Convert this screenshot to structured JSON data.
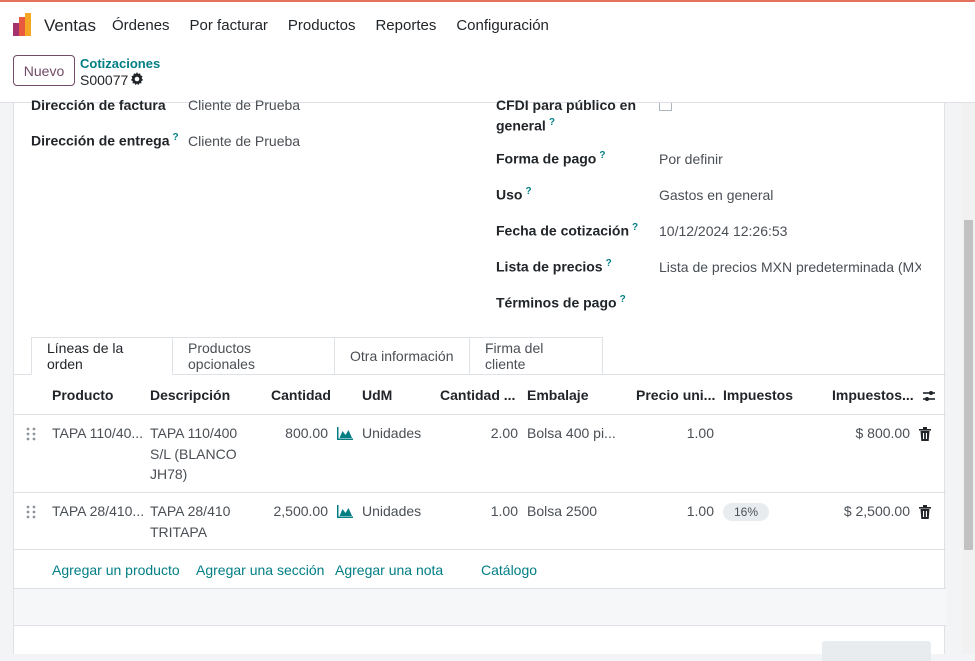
{
  "topbar": {
    "app_name": "Ventas",
    "menu": [
      "Órdenes",
      "Por facturar",
      "Productos",
      "Reportes",
      "Configuración"
    ]
  },
  "control": {
    "new_label": "Nuevo",
    "breadcrumb_parent": "Cotizaciones",
    "breadcrumb_current": "S00077"
  },
  "form": {
    "invoice_address_label": "Dirección de factura",
    "invoice_address_value": "Cliente de Prueba",
    "delivery_address_label": "Dirección de entrega",
    "delivery_address_value": "Cliente de Prueba",
    "cfdi_label_line1": "CFDI para público en",
    "cfdi_label_line2": "general",
    "payment_form_label": "Forma de pago",
    "payment_form_value": "Por definir",
    "use_label": "Uso",
    "use_value": "Gastos en general",
    "quote_date_label": "Fecha de cotización",
    "quote_date_value": "10/12/2024 12:26:53",
    "pricelist_label": "Lista de precios",
    "pricelist_value": "Lista de precios MXN predeterminada (MXN)",
    "payment_terms_label": "Términos de pago",
    "help_mark": "?"
  },
  "tabs": [
    "Líneas de la orden",
    "Productos opcionales",
    "Otra información",
    "Firma del cliente"
  ],
  "table": {
    "headers": [
      "Producto",
      "Descripción",
      "Cantidad",
      "UdM",
      "Cantidad ...",
      "Embalaje",
      "Precio uni...",
      "Impuestos",
      "Impuestos..."
    ],
    "rows": [
      {
        "product": "TAPA 110/40...",
        "description_lines": [
          "TAPA 110/400",
          "S/L (BLANCO",
          "JH78)"
        ],
        "quantity": "800.00",
        "uom": "Unidades",
        "packaging_qty": "2.00",
        "packaging": "Bolsa 400 pi...",
        "unit_price": "1.00",
        "tax": "",
        "subtotal": "$ 800.00"
      },
      {
        "product": "TAPA 28/410...",
        "description_lines": [
          "TAPA 28/410",
          "TRITAPA"
        ],
        "quantity": "2,500.00",
        "uom": "Unidades",
        "packaging_qty": "1.00",
        "packaging": "Bolsa 2500",
        "unit_price": "1.00",
        "tax": "16%",
        "subtotal": "$ 2,500.00"
      }
    ],
    "add_links": [
      "Agregar un producto",
      "Agregar una sección",
      "Agregar una nota",
      "Catálogo"
    ]
  },
  "colors": {
    "accent": "#714b67",
    "link": "#017e84",
    "topbar_border": "#e2725b"
  }
}
